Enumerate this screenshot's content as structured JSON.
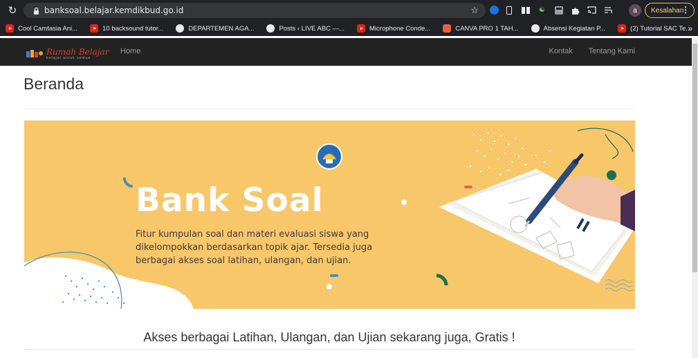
{
  "browser": {
    "url": "banksoal.belajar.kemdikbud.go.id",
    "profile_initial": "a",
    "error_label": "Kesalahan",
    "bookmarks": [
      {
        "label": "Cool Camtasia Ani...",
        "icon": "youtube-icon"
      },
      {
        "label": "10 backsound tutor...",
        "icon": "youtube-icon"
      },
      {
        "label": "DEPARTEMEN AGA...",
        "icon": "globe-icon"
      },
      {
        "label": "Posts ‹ LIVE ABC —...",
        "icon": "globe-icon"
      },
      {
        "label": "Microphone Conde...",
        "icon": "youtube-icon"
      },
      {
        "label": "CANVA PRO 1 TAH...",
        "icon": "shopping-bag-icon"
      },
      {
        "label": "Absensi Kegiatan P...",
        "icon": "globe-icon"
      },
      {
        "label": "(2) Tutorial SAC Te...",
        "icon": "youtube-icon"
      }
    ],
    "more_label": "»"
  },
  "site": {
    "brand_name": "Rumah Belajar",
    "brand_tagline": "belajar untuk semua",
    "nav_home": "Home",
    "nav_right": [
      "Kontak",
      "Tentang Kami"
    ]
  },
  "page": {
    "title": "Beranda",
    "banner_title": "Bank Soal",
    "banner_description": "Fitur kumpulan soal dan materi evaluasi siswa yang dikelompokkan berdasarkan topik ajar. Tersedia juga berbagai akses soal latihan, ulangan, dan ujian.",
    "tagline": "Akses berbagai Latihan, Ulangan, dan Ujian sekarang juga, Gratis !"
  },
  "colors": {
    "banner_bg": "#f8c76a",
    "navbar_bg": "#222222",
    "chrome_bg": "#202124"
  }
}
